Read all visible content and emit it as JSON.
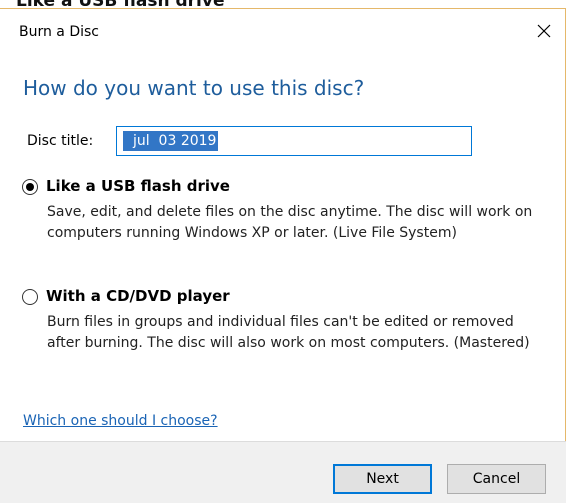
{
  "caption": "Like a USB flash drive",
  "window": {
    "title": "Burn a Disc",
    "close_icon": "close-icon"
  },
  "heading": "How do you want to use this disc?",
  "disc_title": {
    "label": "Disc title:",
    "value": "jul  03 2019"
  },
  "options": [
    {
      "label": "Like a USB flash drive",
      "selected": true,
      "description": "Save, edit, and delete files on the disc anytime. The disc will work on computers running Windows XP or later. (Live File System)"
    },
    {
      "label": "With a CD/DVD player",
      "selected": false,
      "description": "Burn files in groups and individual files can't be edited or removed after burning. The disc will also work on most computers. (Mastered)"
    }
  ],
  "help_link": "Which one should I choose?",
  "buttons": {
    "next": "Next",
    "cancel": "Cancel"
  },
  "colors": {
    "heading": "#1e5d9c",
    "link": "#1a64b5",
    "selection": "#3276c6",
    "accent_border": "#0078d7"
  }
}
